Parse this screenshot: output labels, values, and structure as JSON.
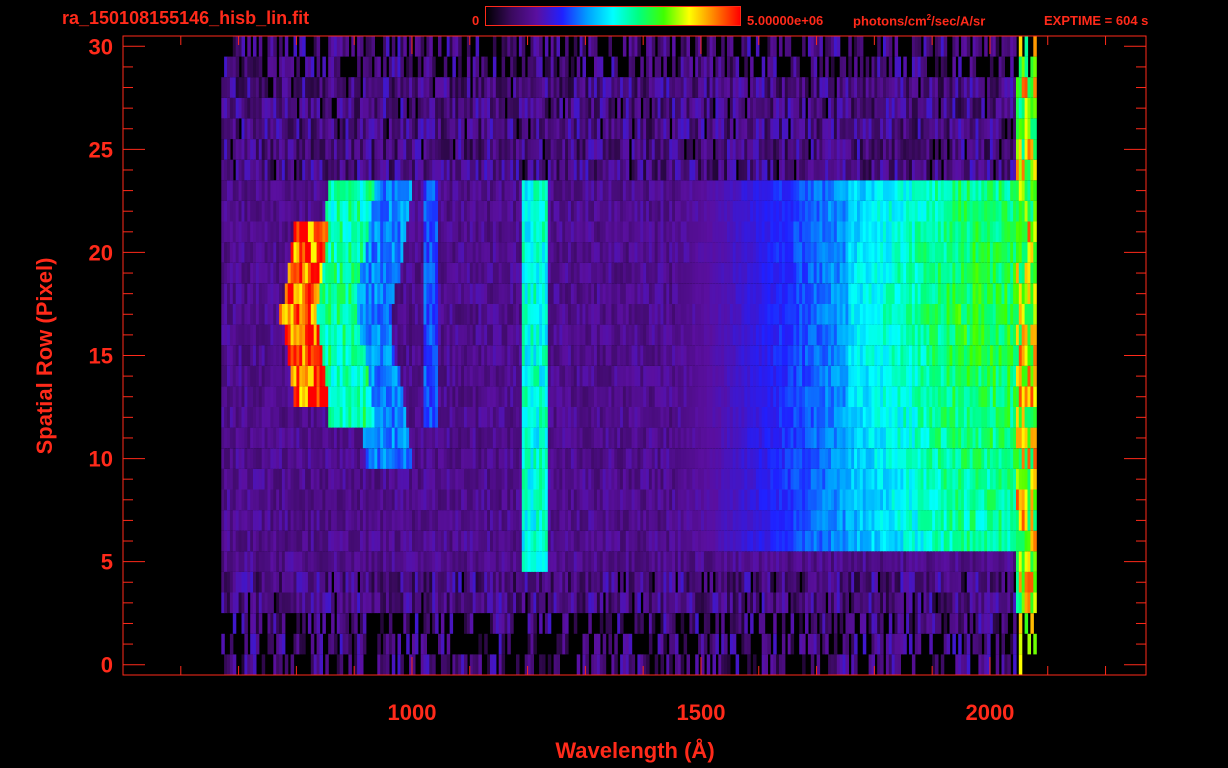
{
  "header": {
    "filename": "ra_150108155146_hisb_lin.fit",
    "colorbar_min": "0",
    "colorbar_max": "5.00000e+06",
    "colorbar_units_pre": "photons/cm",
    "colorbar_units_sup": "2",
    "colorbar_units_post": "/sec/A/sr",
    "exptime": "EXPTIME = 604 s"
  },
  "colors": {
    "background": "#000000",
    "axis": "#ff2a1a",
    "colormap": [
      "#000000",
      "#3a0a5e",
      "#5a0fa0",
      "#2020ff",
      "#00a0ff",
      "#00ffff",
      "#00ff80",
      "#40ff00",
      "#ffff00",
      "#ff8000",
      "#ff0000"
    ]
  },
  "chart_data": {
    "type": "heatmap",
    "title": "ra_150108155146_hisb_lin.fit",
    "xlabel": "Wavelength (Å)",
    "ylabel": "Spatial Row (Pixel)",
    "xlim": [
      500,
      2270
    ],
    "ylim": [
      -0.5,
      30.5
    ],
    "xticks": [
      1000,
      1500,
      2000
    ],
    "xtick_labels": [
      "1000",
      "1500",
      "2000"
    ],
    "yticks": [
      0,
      5,
      10,
      15,
      20,
      25,
      30
    ],
    "ytick_labels": [
      "0",
      "5",
      "10",
      "15",
      "20",
      "25",
      "30"
    ],
    "colorbar": {
      "min": 0,
      "max": 5000000,
      "units": "photons/cm^2/sec/A/sr"
    },
    "data_extent_x": [
      670,
      2080
    ],
    "features": [
      {
        "name": "arc-core",
        "x_range": [
          770,
          830
        ],
        "rows": [
          13,
          21
        ],
        "level": 1.0
      },
      {
        "name": "arc-inner",
        "x_range": [
          820,
          900
        ],
        "rows": [
          12,
          23
        ],
        "level": 0.6
      },
      {
        "name": "arc-outer",
        "x_range": [
          880,
          960
        ],
        "rows": [
          10,
          23
        ],
        "level": 0.4
      },
      {
        "name": "line-1025",
        "x_range": [
          1020,
          1040
        ],
        "rows": [
          12,
          23
        ],
        "level": 0.35
      },
      {
        "name": "line-1216",
        "x_range": [
          1190,
          1230
        ],
        "rows": [
          5,
          24
        ],
        "level": 0.55
      },
      {
        "name": "continuum",
        "x_range": [
          1600,
          2070
        ],
        "rows": [
          6,
          23
        ],
        "level": 0.5
      }
    ]
  }
}
